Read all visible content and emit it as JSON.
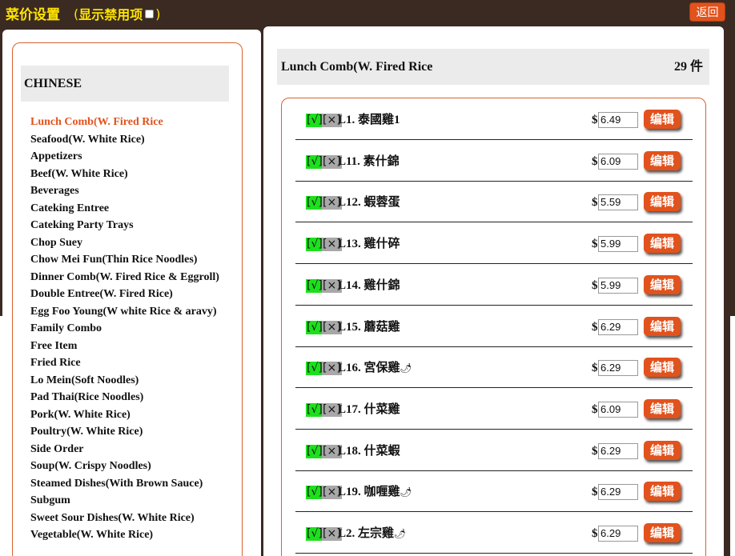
{
  "header": {
    "title": "菜价设置",
    "toggle_open": "(",
    "toggle_label": "显示禁用项",
    "toggle_close": ")",
    "back_label": "返回"
  },
  "categories": {
    "header": "CHINESE",
    "items": [
      "Lunch Comb(W. Fired Rice",
      "Seafood(W. White Rice)",
      "Appetizers",
      "Beef(W. White Rice)",
      "Beverages",
      "Cateking Entree",
      "Cateking Party Trays",
      "Chop Suey",
      "Chow Mei Fun(Thin Rice Noodles)",
      "Dinner Comb(W. Fired Rice & Eggroll)",
      "Double Entree(W. Fired Rice)",
      "Egg Foo Young(W white Rice & aravy)",
      "Family Combo",
      "Free Item",
      "Fried Rice",
      "Lo Mein(Soft Noodles)",
      "Pad Thai(Rice Noodles)",
      "Pork(W. White Rice)",
      "Poultry(W. White Rice)",
      "Side Order",
      "Soup(W. Crispy Noodles)",
      "Steamed Dishes(With Brown Sauce)",
      "Subgum",
      "Sweet Sour Dishes(W. White Rice)",
      "Vegetable(W. White Rice)"
    ]
  },
  "main": {
    "title": "Lunch Comb(W. Fired Rice",
    "count": "29 件",
    "enable_label": "[√]",
    "disable_label": "[×]",
    "currency": "$",
    "edit_label": "编辑",
    "items": [
      {
        "name": "L1.  泰國雞1",
        "chili": "",
        "price": "6.49"
      },
      {
        "name": "L11.  素什錦",
        "chili": "",
        "price": "6.09"
      },
      {
        "name": "L12.  蝦蓉蛋",
        "chili": "",
        "price": "5.59"
      },
      {
        "name": "L13.  雞什碎",
        "chili": "",
        "price": "5.99"
      },
      {
        "name": "L14.  雞什錦",
        "chili": "",
        "price": "5.99"
      },
      {
        "name": "L15.  蘑菇雞",
        "chili": "",
        "price": "6.29"
      },
      {
        "name": "L16.  宮保雞",
        "chili": "🌶",
        "price": "6.29"
      },
      {
        "name": "L17.  什菜雞",
        "chili": "",
        "price": "6.09"
      },
      {
        "name": "L18.  什菜蝦",
        "chili": "",
        "price": "6.29"
      },
      {
        "name": "L19.  咖喱雞",
        "chili": "🌶",
        "price": "6.29"
      },
      {
        "name": "L2.  左宗雞",
        "chili": "🌶",
        "price": "6.29"
      }
    ]
  }
}
